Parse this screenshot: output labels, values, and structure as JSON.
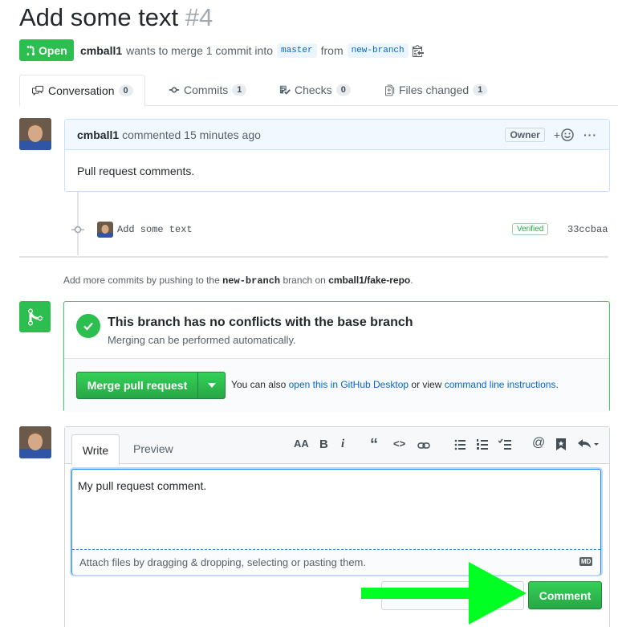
{
  "pr": {
    "title": "Add some text",
    "number": "#4",
    "state": "Open",
    "author": "cmball1",
    "merge_text": "wants to merge 1 commit into",
    "base_branch": "master",
    "from_text": "from",
    "head_branch": "new-branch"
  },
  "tabs": [
    {
      "label": "Conversation",
      "count": "0"
    },
    {
      "label": "Commits",
      "count": "1"
    },
    {
      "label": "Checks",
      "count": "0"
    },
    {
      "label": "Files changed",
      "count": "1"
    }
  ],
  "comment": {
    "author": "cmball1",
    "action": "commented 15 minutes ago",
    "badge": "Owner",
    "add_reaction": "+",
    "more": "···",
    "body": "Pull request comments."
  },
  "commit": {
    "message": "Add some text",
    "verified": "Verified",
    "sha": "33ccbaa"
  },
  "hint": {
    "prefix": "Add more commits by pushing to the",
    "branch": "new-branch",
    "middle": "branch on",
    "repo": "cmball1/fake-repo",
    "suffix": "."
  },
  "merge": {
    "title": "This branch has no conflicts with the base branch",
    "subtitle": "Merging can be performed automatically.",
    "button": "Merge pull request",
    "also": "You can also",
    "desktop_link": "open this in GitHub Desktop",
    "or_view": "or view",
    "cli_link": "command line instructions",
    "period": "."
  },
  "editor": {
    "tab_write": "Write",
    "tab_preview": "Preview",
    "text": "My pull request comment.",
    "attach": "Attach files by dragging & dropping, selecting or pasting them.",
    "md_badge": "MD",
    "comment_button": "Comment"
  },
  "colors": {
    "green": "#2cbe4e",
    "link": "#0366d6",
    "arrow": "#00ff22"
  }
}
